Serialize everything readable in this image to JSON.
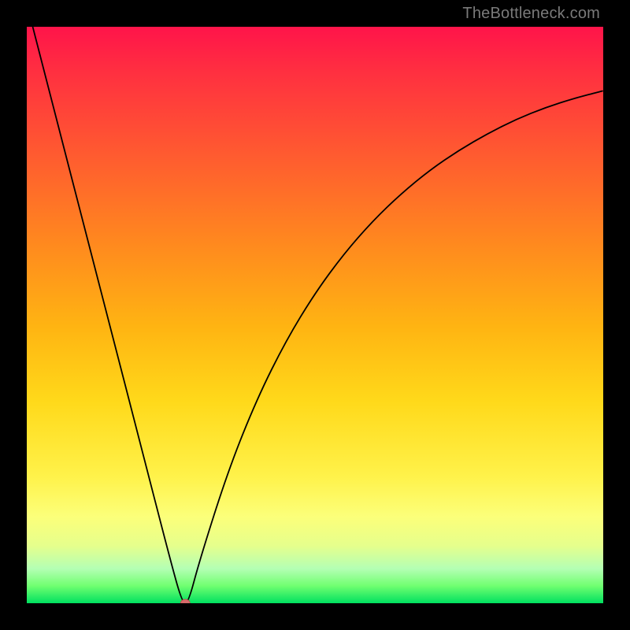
{
  "attribution": "TheBottleneck.com",
  "chart_data": {
    "type": "line",
    "title": "",
    "xlabel": "",
    "ylabel": "",
    "xlim": [
      0,
      100
    ],
    "ylim": [
      0,
      100
    ],
    "series": [
      {
        "name": "bottleneck-curve",
        "x": [
          0,
          5,
          10,
          15,
          20,
          25,
          27,
          28,
          30,
          35,
          40,
          45,
          50,
          55,
          60,
          65,
          70,
          75,
          80,
          85,
          90,
          95,
          100
        ],
        "y": [
          104,
          84.6,
          65.2,
          45.9,
          26.5,
          7.1,
          0,
          0,
          7.5,
          23.2,
          35.6,
          45.6,
          53.8,
          60.6,
          66.3,
          71.1,
          75.2,
          78.6,
          81.5,
          84.0,
          86.0,
          87.6,
          88.9
        ]
      }
    ],
    "annotations": [
      {
        "name": "minimum-marker",
        "x": 27.5,
        "y": 0
      }
    ],
    "background": {
      "type": "vertical-gradient",
      "stops": [
        {
          "pos": 0.0,
          "color": "#ff144a"
        },
        {
          "pos": 0.08,
          "color": "#ff3040"
        },
        {
          "pos": 0.22,
          "color": "#ff5a30"
        },
        {
          "pos": 0.38,
          "color": "#ff8a1e"
        },
        {
          "pos": 0.52,
          "color": "#ffb412"
        },
        {
          "pos": 0.65,
          "color": "#ffd91a"
        },
        {
          "pos": 0.78,
          "color": "#fff24a"
        },
        {
          "pos": 0.85,
          "color": "#fcff7a"
        },
        {
          "pos": 0.9,
          "color": "#e6ff8c"
        },
        {
          "pos": 0.94,
          "color": "#b4ffb4"
        },
        {
          "pos": 0.97,
          "color": "#70ff70"
        },
        {
          "pos": 1.0,
          "color": "#00e060"
        }
      ]
    }
  }
}
